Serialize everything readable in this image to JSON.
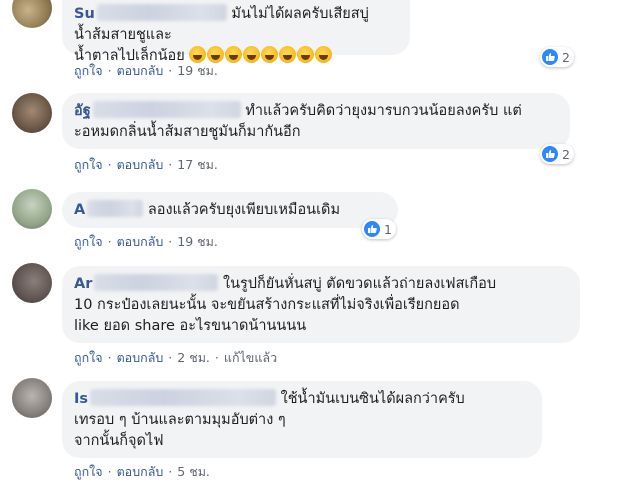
{
  "actions": {
    "like": "ถูกใจ",
    "reply": "ตอบกลับ",
    "sep": "·",
    "edited": "แก้ไขแล้ว"
  },
  "comments": [
    {
      "name_visible": "Su",
      "text": "มันไม่ได้ผลครับเสียสบู่น้ำส้มสายชูและ\nน้ำตาลไปเล็กน้อย",
      "emojis": [
        "relieved",
        "relieved",
        "relieved",
        "relieved",
        "laughing",
        "laughing",
        "laughing",
        "laughing"
      ],
      "reaction_count": "2",
      "time": "19 ชม."
    },
    {
      "name_visible": "อัฐ",
      "text_line1": "ทำแล้วครับคิดว่ายุงมารบกวนน้อยลงครับ แต่",
      "text_line2": "ะอหมดกลิ่นน้ำส้มสายชูมันก็มากันอีก",
      "reaction_count": "2",
      "time": "17 ชม."
    },
    {
      "name_visible": "A",
      "text": "ลองแล้วครับยุงเพียบเหมือนเดิม",
      "reaction_count": "1",
      "time": "19 ชม."
    },
    {
      "name_visible": "Ar",
      "text_line1": "ในรูปก็ยันหั่นสบู่ ตัดขวดแล้วถ่ายลงเฟสเกือบ",
      "text_line2": "10 กระป๋องเลยนะนั้น จะขยันสร้างกระแสที่ไม่จริงเพื่อเรียกยอด",
      "text_line3": "like ยอด share อะไรขนาดน้านนนน",
      "time": "2 ชม."
    },
    {
      "name_visible": "Is",
      "text_line1": "ใช้น้ำมันเบนซินได้ผลกว่าครับ",
      "text_line2": "เทรอบ ๆ บ้านและตามมุมอับต่าง ๆ",
      "text_line3": "จากนั้นก็จุดไฟ",
      "time": "5 ชม."
    }
  ]
}
